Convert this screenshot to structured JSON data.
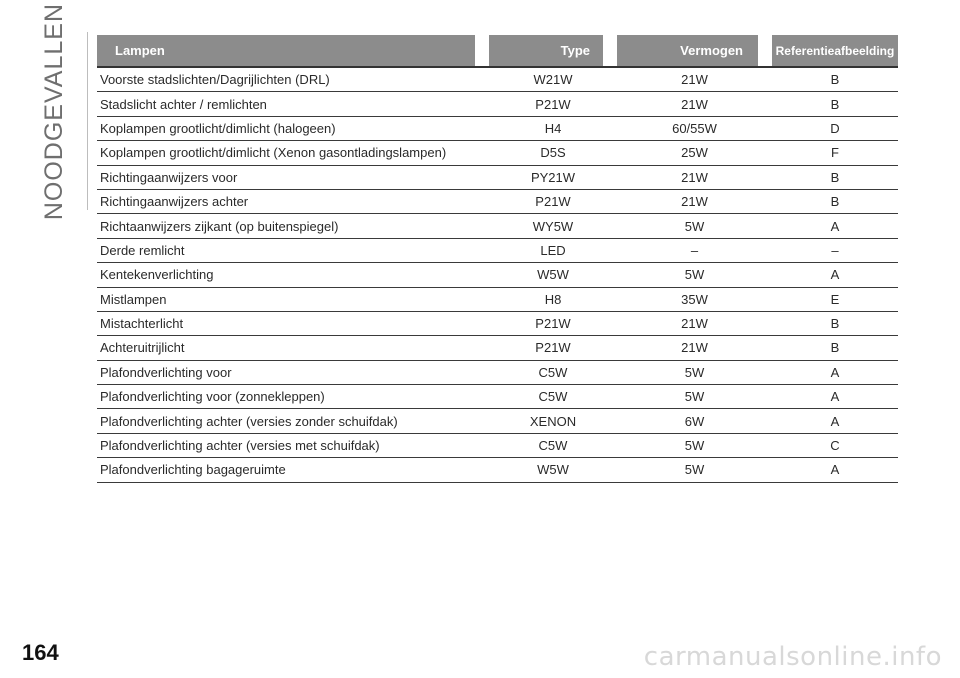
{
  "section_title": "NOODGEVALLEN",
  "page_number": "164",
  "watermark": "carmanualsonline.info",
  "table": {
    "headers": {
      "lamp": "Lampen",
      "type": "Type",
      "vermogen": "Vermogen",
      "ref": "Referentieafbeelding"
    },
    "rows": [
      {
        "lamp": "Voorste stadslichten/Dagrijlichten (DRL)",
        "type": "W21W",
        "vermogen": "21W",
        "ref": "B"
      },
      {
        "lamp": "Stadslicht achter / remlichten",
        "type": "P21W",
        "vermogen": "21W",
        "ref": "B"
      },
      {
        "lamp": "Koplampen grootlicht/dimlicht (halogeen)",
        "type": "H4",
        "vermogen": "60/55W",
        "ref": "D"
      },
      {
        "lamp": "Koplampen grootlicht/dimlicht (Xenon gasontladingslampen)",
        "type": "D5S",
        "vermogen": "25W",
        "ref": "F"
      },
      {
        "lamp": "Richtingaanwijzers voor",
        "type": "PY21W",
        "vermogen": "21W",
        "ref": "B"
      },
      {
        "lamp": "Richtingaanwijzers achter",
        "type": "P21W",
        "vermogen": "21W",
        "ref": "B"
      },
      {
        "lamp": "Richtaanwijzers zijkant (op buitenspiegel)",
        "type": "WY5W",
        "vermogen": "5W",
        "ref": "A"
      },
      {
        "lamp": "Derde remlicht",
        "type": "LED",
        "vermogen": "–",
        "ref": "–"
      },
      {
        "lamp": "Kentekenverlichting",
        "type": "W5W",
        "vermogen": "5W",
        "ref": "A"
      },
      {
        "lamp": "Mistlampen",
        "type": "H8",
        "vermogen": "35W",
        "ref": "E"
      },
      {
        "lamp": "Mistachterlicht",
        "type": "P21W",
        "vermogen": "21W",
        "ref": "B"
      },
      {
        "lamp": "Achteruitrijlicht",
        "type": "P21W",
        "vermogen": "21W",
        "ref": "B"
      },
      {
        "lamp": "Plafondverlichting voor",
        "type": "C5W",
        "vermogen": "5W",
        "ref": "A"
      },
      {
        "lamp": "Plafondverlichting voor (zonnekleppen)",
        "type": "C5W",
        "vermogen": "5W",
        "ref": "A"
      },
      {
        "lamp": "Plafondverlichting achter (versies zonder schuifdak)",
        "type": "XENON",
        "vermogen": "6W",
        "ref": "A"
      },
      {
        "lamp": "Plafondverlichting achter (versies met schuifdak)",
        "type": "C5W",
        "vermogen": "5W",
        "ref": "C"
      },
      {
        "lamp": "Plafondverlichting bagageruimte",
        "type": "W5W",
        "vermogen": "5W",
        "ref": "A"
      }
    ]
  }
}
